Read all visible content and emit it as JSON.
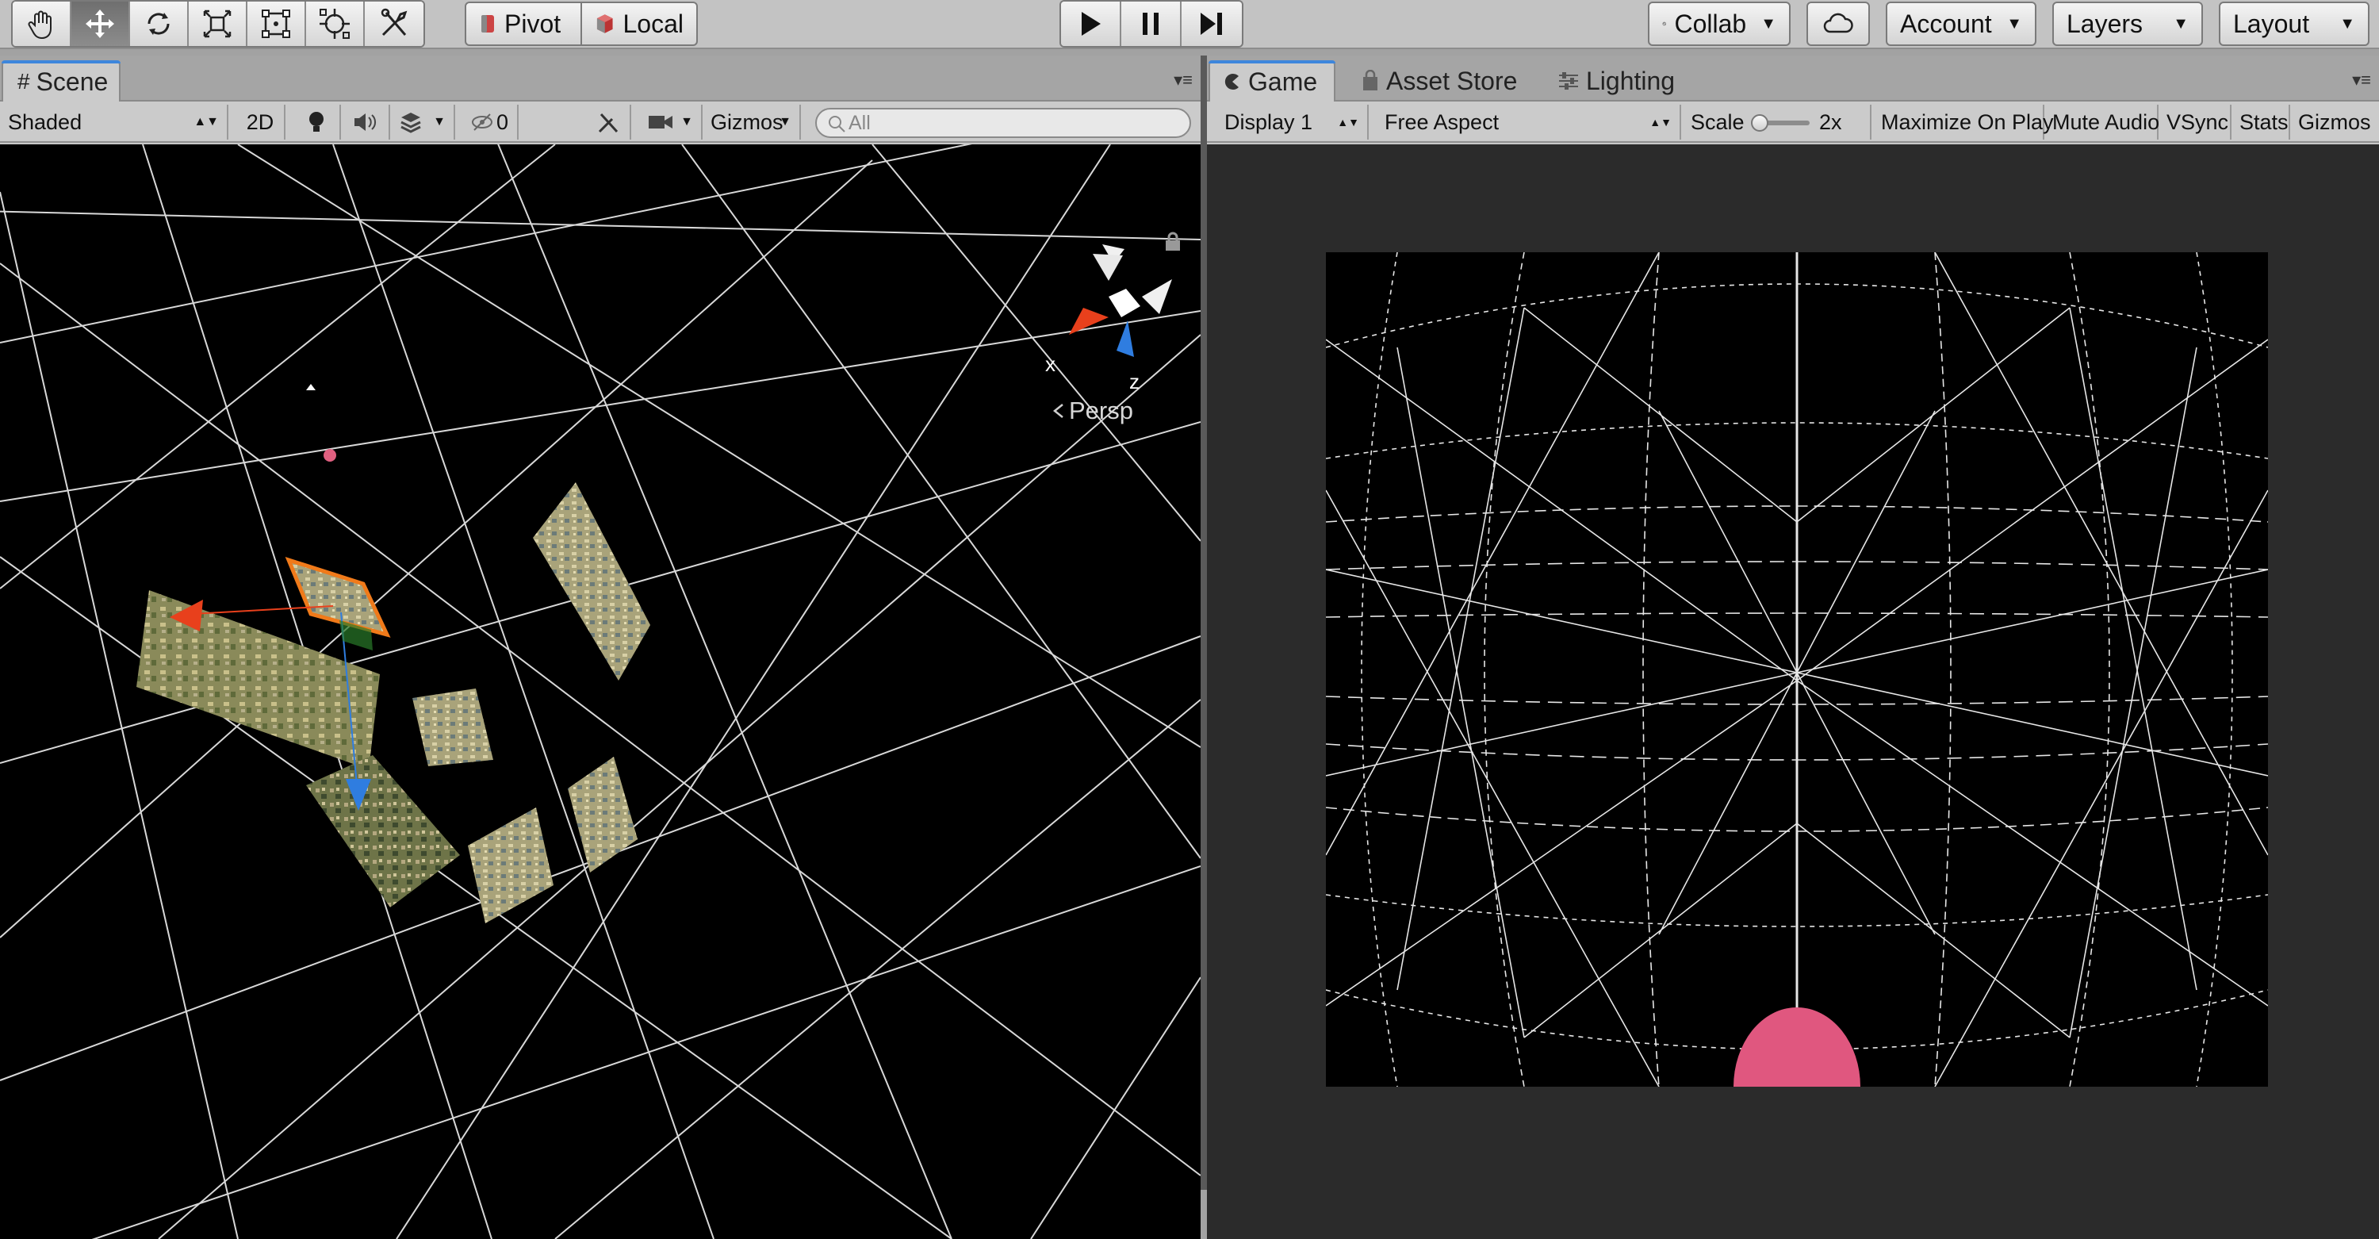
{
  "toolbar": {
    "transform_tools": [
      {
        "name": "hand-tool-button",
        "icon": "hand-icon",
        "active": false
      },
      {
        "name": "move-tool-button",
        "icon": "move-arrows-icon",
        "active": true
      },
      {
        "name": "rotate-tool-button",
        "icon": "rotate-icon",
        "active": false
      },
      {
        "name": "scale-tool-button",
        "icon": "scale-icon",
        "active": false
      },
      {
        "name": "rect-tool-button",
        "icon": "rect-transform-icon",
        "active": false
      },
      {
        "name": "transform-tool-button",
        "icon": "combined-transform-icon",
        "active": false
      },
      {
        "name": "custom-tool-button",
        "icon": "custom-editor-tool-icon",
        "active": false
      }
    ],
    "pivot_label": "Pivot",
    "local_label": "Local",
    "collab_label": "Collab",
    "account_label": "Account",
    "layers_label": "Layers",
    "layout_label": "Layout"
  },
  "scene": {
    "tab_label": "Scene",
    "shading_mode": "Shaded",
    "mode_2d_label": "2D",
    "hidden_count": "0",
    "gizmos_label": "Gizmos",
    "search_placeholder": "All",
    "persp_label": "Persp",
    "axis_x": "x",
    "axis_z": "z"
  },
  "game": {
    "tabs": [
      "Game",
      "Asset Store",
      "Lighting"
    ],
    "display": "Display 1",
    "aspect": "Free Aspect",
    "scale_label": "Scale",
    "scale_value": "2x",
    "maximize_on_play": "Maximize On Play",
    "mute_audio": "Mute Audio",
    "vsync": "VSync",
    "stats": "Stats",
    "gizmos": "Gizmos"
  },
  "colors": {
    "accent_tab": "#3d86dc",
    "sphere_pink": "#e0577f",
    "gizmo_x": "#e8401c",
    "gizmo_z": "#2f7de0",
    "selection_orange": "#f07a1a"
  }
}
